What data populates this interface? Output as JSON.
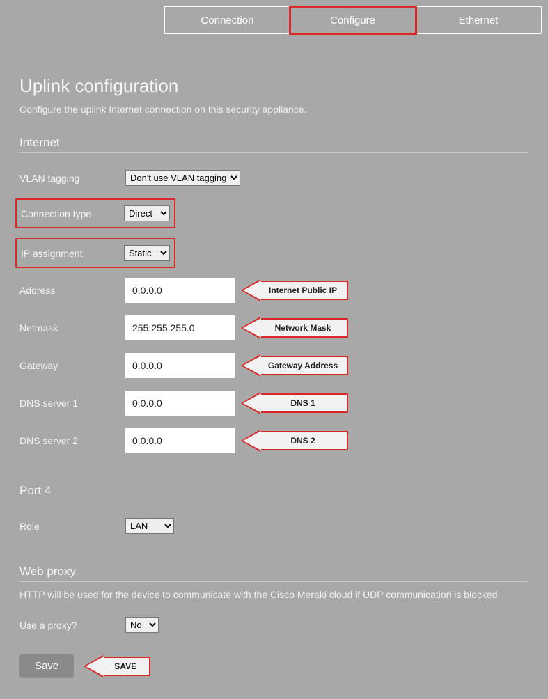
{
  "tabs": {
    "connection": "Connection",
    "configure": "Configure",
    "ethernet": "Ethernet"
  },
  "page": {
    "title": "Uplink configuration",
    "subtitle": "Configure the uplink Internet connection on this security appliance."
  },
  "internet": {
    "header": "Internet",
    "vlan_label": "VLAN tagging",
    "vlan_value": "Don't use VLAN tagging",
    "conn_label": "Connection type",
    "conn_value": "Direct",
    "ip_label": "IP assignment",
    "ip_value": "Static",
    "address_label": "Address",
    "address_value": "0.0.0.0",
    "address_callout": "Internet Public IP",
    "netmask_label": "Netmask",
    "netmask_value": "255.255.255.0",
    "netmask_callout": "Network Mask",
    "gateway_label": "Gateway",
    "gateway_value": "0.0.0.0",
    "gateway_callout": "Gateway Address",
    "dns1_label": "DNS server 1",
    "dns1_value": "0.0.0.0",
    "dns1_callout": "DNS 1",
    "dns2_label": "DNS server 2",
    "dns2_value": "0.0.0.0",
    "dns2_callout": "DNS 2"
  },
  "port4": {
    "header": "Port 4",
    "role_label": "Role",
    "role_value": "LAN"
  },
  "proxy": {
    "header": "Web proxy",
    "desc": "HTTP will be used for the device to communicate with the Cisco Meraki cloud if UDP communication is blocked",
    "use_label": "Use a proxy?",
    "use_value": "No"
  },
  "save": {
    "button": "Save",
    "callout": "SAVE"
  }
}
